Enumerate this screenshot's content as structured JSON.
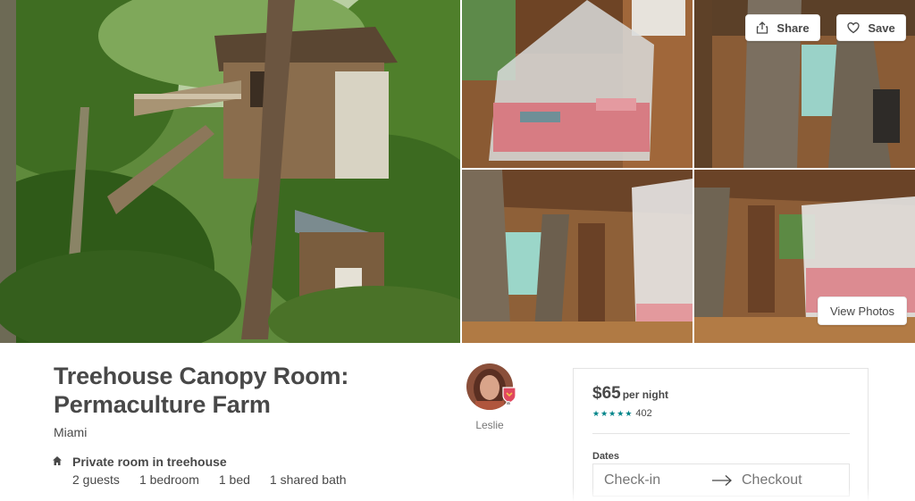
{
  "gallery": {
    "share_label": "Share",
    "save_label": "Save",
    "view_photos_label": "View Photos"
  },
  "listing": {
    "title": "Treehouse Canopy Room: Permaculture Farm",
    "city": "Miami",
    "room_type": "Private room in treehouse",
    "amenities": [
      "2 guests",
      "1 bedroom",
      "1 bed",
      "1 shared bath"
    ]
  },
  "host": {
    "name": "Leslie"
  },
  "booking": {
    "price": "$65",
    "per_night": "per night",
    "rating_stars": 5,
    "review_count": "402",
    "dates_label": "Dates",
    "checkin_placeholder": "Check-in",
    "checkout_placeholder": "Checkout"
  },
  "colors": {
    "accent_teal": "#008489",
    "text": "#484848",
    "muted": "#767676",
    "border": "#e4e4e4"
  },
  "icons": [
    "share-icon",
    "heart-icon",
    "home-icon",
    "arrow-right-icon",
    "superhost-badge-icon",
    "star-icon"
  ]
}
